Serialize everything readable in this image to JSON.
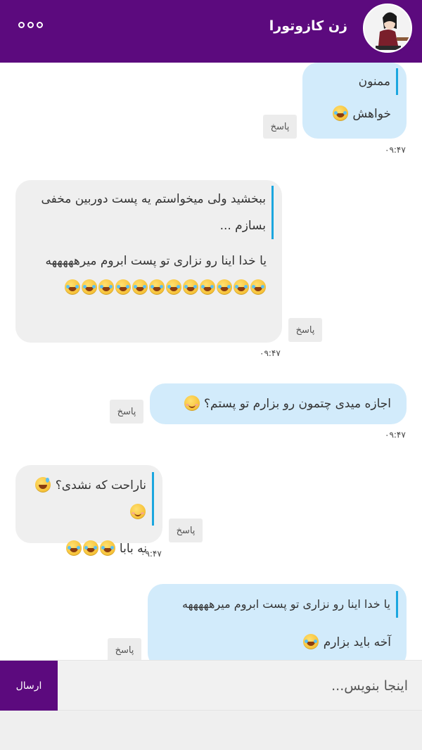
{
  "header": {
    "title": "زن کازوتورا",
    "menu_icon": "more-options-icon",
    "background": "#5c0a7e"
  },
  "messages": [
    {
      "direction": "outgoing",
      "quote": "ممنون",
      "text": "خواهش",
      "emojis": [
        "rofl"
      ],
      "time": "۰۹:۴۷",
      "reply_label": "پاسخ"
    },
    {
      "direction": "incoming",
      "quote": "ببخشید ولی میخواستم یه پست دوربین مخفی بسازم ...",
      "text": "یا خدا اینا رو نزاری تو پست ابروم میرهههههه",
      "emojis": [
        "rofl",
        "rofl",
        "rofl",
        "rofl",
        "rofl",
        "rofl",
        "rofl",
        "rofl",
        "rofl",
        "rofl",
        "rofl",
        "rofl"
      ],
      "time": "۰۹:۴۷",
      "reply_label": "پاسخ"
    },
    {
      "direction": "outgoing",
      "text": "اجازه میدی چتمون رو بزارم تو پستم؟",
      "emojis": [
        "smiling"
      ],
      "time": "۰۹:۴۷",
      "reply_label": "پاسخ"
    },
    {
      "direction": "incoming",
      "quote": "ناراحت که نشدی؟",
      "text": "نه بابا",
      "emojis": [
        "rofl",
        "rofl",
        "rofl"
      ],
      "time": "۰۹:۴۷",
      "reply_label": "پاسخ"
    },
    {
      "direction": "outgoing",
      "quote": "یا خدا اینا رو نزاری تو پست ابروم میرهههههه",
      "text": "آخه باید بزارم",
      "emojis": [
        "rofl"
      ],
      "time": "",
      "reply_label": "پاسخ"
    }
  ],
  "composer": {
    "placeholder": "اینجا بنویس...",
    "value": "",
    "send_label": "ارسال"
  }
}
